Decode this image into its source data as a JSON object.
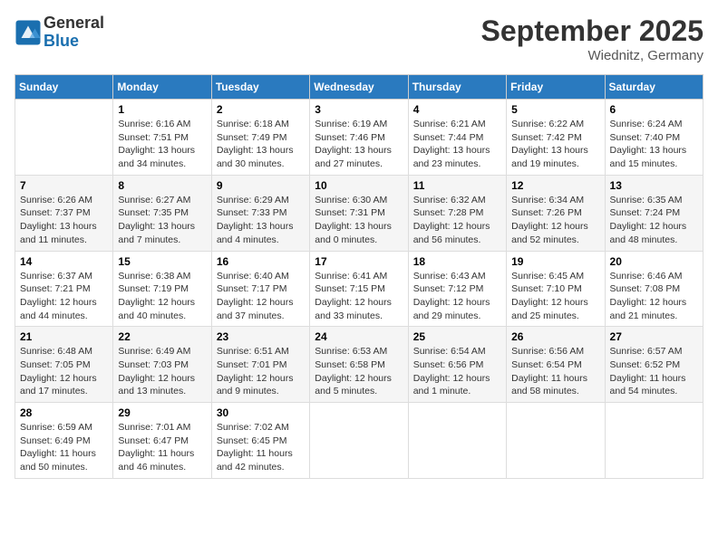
{
  "logo": {
    "general": "General",
    "blue": "Blue"
  },
  "title": "September 2025",
  "location": "Wiednitz, Germany",
  "days_of_week": [
    "Sunday",
    "Monday",
    "Tuesday",
    "Wednesday",
    "Thursday",
    "Friday",
    "Saturday"
  ],
  "weeks": [
    [
      {
        "day": "",
        "info": ""
      },
      {
        "day": "1",
        "info": "Sunrise: 6:16 AM\nSunset: 7:51 PM\nDaylight: 13 hours\nand 34 minutes."
      },
      {
        "day": "2",
        "info": "Sunrise: 6:18 AM\nSunset: 7:49 PM\nDaylight: 13 hours\nand 30 minutes."
      },
      {
        "day": "3",
        "info": "Sunrise: 6:19 AM\nSunset: 7:46 PM\nDaylight: 13 hours\nand 27 minutes."
      },
      {
        "day": "4",
        "info": "Sunrise: 6:21 AM\nSunset: 7:44 PM\nDaylight: 13 hours\nand 23 minutes."
      },
      {
        "day": "5",
        "info": "Sunrise: 6:22 AM\nSunset: 7:42 PM\nDaylight: 13 hours\nand 19 minutes."
      },
      {
        "day": "6",
        "info": "Sunrise: 6:24 AM\nSunset: 7:40 PM\nDaylight: 13 hours\nand 15 minutes."
      }
    ],
    [
      {
        "day": "7",
        "info": "Sunrise: 6:26 AM\nSunset: 7:37 PM\nDaylight: 13 hours\nand 11 minutes."
      },
      {
        "day": "8",
        "info": "Sunrise: 6:27 AM\nSunset: 7:35 PM\nDaylight: 13 hours\nand 7 minutes."
      },
      {
        "day": "9",
        "info": "Sunrise: 6:29 AM\nSunset: 7:33 PM\nDaylight: 13 hours\nand 4 minutes."
      },
      {
        "day": "10",
        "info": "Sunrise: 6:30 AM\nSunset: 7:31 PM\nDaylight: 13 hours\nand 0 minutes."
      },
      {
        "day": "11",
        "info": "Sunrise: 6:32 AM\nSunset: 7:28 PM\nDaylight: 12 hours\nand 56 minutes."
      },
      {
        "day": "12",
        "info": "Sunrise: 6:34 AM\nSunset: 7:26 PM\nDaylight: 12 hours\nand 52 minutes."
      },
      {
        "day": "13",
        "info": "Sunrise: 6:35 AM\nSunset: 7:24 PM\nDaylight: 12 hours\nand 48 minutes."
      }
    ],
    [
      {
        "day": "14",
        "info": "Sunrise: 6:37 AM\nSunset: 7:21 PM\nDaylight: 12 hours\nand 44 minutes."
      },
      {
        "day": "15",
        "info": "Sunrise: 6:38 AM\nSunset: 7:19 PM\nDaylight: 12 hours\nand 40 minutes."
      },
      {
        "day": "16",
        "info": "Sunrise: 6:40 AM\nSunset: 7:17 PM\nDaylight: 12 hours\nand 37 minutes."
      },
      {
        "day": "17",
        "info": "Sunrise: 6:41 AM\nSunset: 7:15 PM\nDaylight: 12 hours\nand 33 minutes."
      },
      {
        "day": "18",
        "info": "Sunrise: 6:43 AM\nSunset: 7:12 PM\nDaylight: 12 hours\nand 29 minutes."
      },
      {
        "day": "19",
        "info": "Sunrise: 6:45 AM\nSunset: 7:10 PM\nDaylight: 12 hours\nand 25 minutes."
      },
      {
        "day": "20",
        "info": "Sunrise: 6:46 AM\nSunset: 7:08 PM\nDaylight: 12 hours\nand 21 minutes."
      }
    ],
    [
      {
        "day": "21",
        "info": "Sunrise: 6:48 AM\nSunset: 7:05 PM\nDaylight: 12 hours\nand 17 minutes."
      },
      {
        "day": "22",
        "info": "Sunrise: 6:49 AM\nSunset: 7:03 PM\nDaylight: 12 hours\nand 13 minutes."
      },
      {
        "day": "23",
        "info": "Sunrise: 6:51 AM\nSunset: 7:01 PM\nDaylight: 12 hours\nand 9 minutes."
      },
      {
        "day": "24",
        "info": "Sunrise: 6:53 AM\nSunset: 6:58 PM\nDaylight: 12 hours\nand 5 minutes."
      },
      {
        "day": "25",
        "info": "Sunrise: 6:54 AM\nSunset: 6:56 PM\nDaylight: 12 hours\nand 1 minute."
      },
      {
        "day": "26",
        "info": "Sunrise: 6:56 AM\nSunset: 6:54 PM\nDaylight: 11 hours\nand 58 minutes."
      },
      {
        "day": "27",
        "info": "Sunrise: 6:57 AM\nSunset: 6:52 PM\nDaylight: 11 hours\nand 54 minutes."
      }
    ],
    [
      {
        "day": "28",
        "info": "Sunrise: 6:59 AM\nSunset: 6:49 PM\nDaylight: 11 hours\nand 50 minutes."
      },
      {
        "day": "29",
        "info": "Sunrise: 7:01 AM\nSunset: 6:47 PM\nDaylight: 11 hours\nand 46 minutes."
      },
      {
        "day": "30",
        "info": "Sunrise: 7:02 AM\nSunset: 6:45 PM\nDaylight: 11 hours\nand 42 minutes."
      },
      {
        "day": "",
        "info": ""
      },
      {
        "day": "",
        "info": ""
      },
      {
        "day": "",
        "info": ""
      },
      {
        "day": "",
        "info": ""
      }
    ]
  ]
}
